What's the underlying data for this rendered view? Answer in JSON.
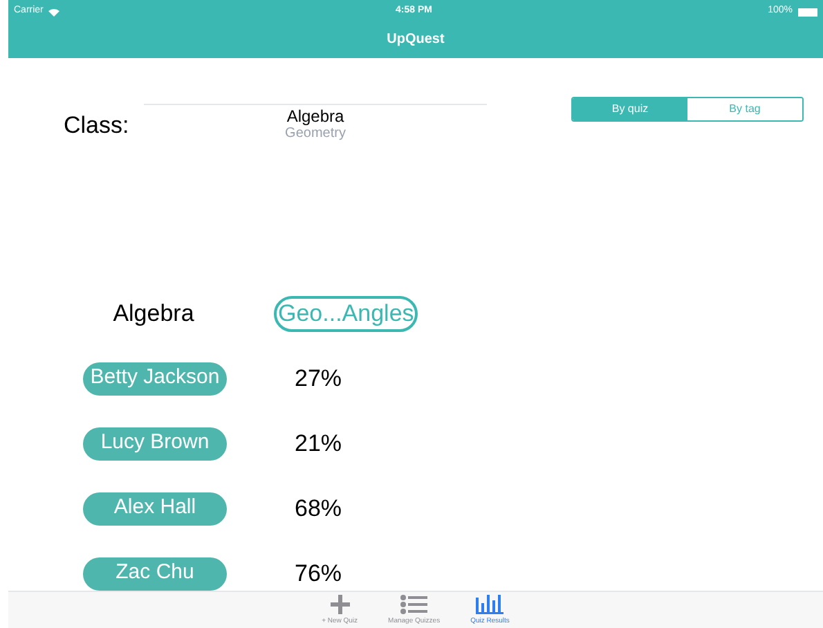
{
  "status_bar": {
    "carrier": "Carrier",
    "time": "4:58 PM",
    "battery": "100%"
  },
  "nav_bar": {
    "title": "UpQuest"
  },
  "class_picker": {
    "label": "Class:",
    "options": [
      {
        "label": "Algebra",
        "selected": true
      },
      {
        "label": "Geometry",
        "selected": false
      }
    ]
  },
  "segments": [
    {
      "label": "By quiz",
      "selected": true
    },
    {
      "label": "By tag",
      "selected": false
    }
  ],
  "table": {
    "columns": [
      {
        "label": "Algebra",
        "kind": "text"
      },
      {
        "label": "Geo...Angles",
        "kind": "button"
      }
    ],
    "rows": [
      {
        "student": "Betty Jackson",
        "score": "27%"
      },
      {
        "student": "Lucy Brown",
        "score": "21%"
      },
      {
        "student": "Alex Hall",
        "score": "68%"
      },
      {
        "student": "Zac Chu",
        "score": "76%"
      }
    ]
  },
  "tab_bar": [
    {
      "label": "+ New Quiz",
      "kind": "plus",
      "selected": false
    },
    {
      "label": "Manage Quizzes",
      "kind": "list",
      "selected": false
    },
    {
      "label": "Quiz Results",
      "kind": "chart",
      "selected": true
    }
  ]
}
